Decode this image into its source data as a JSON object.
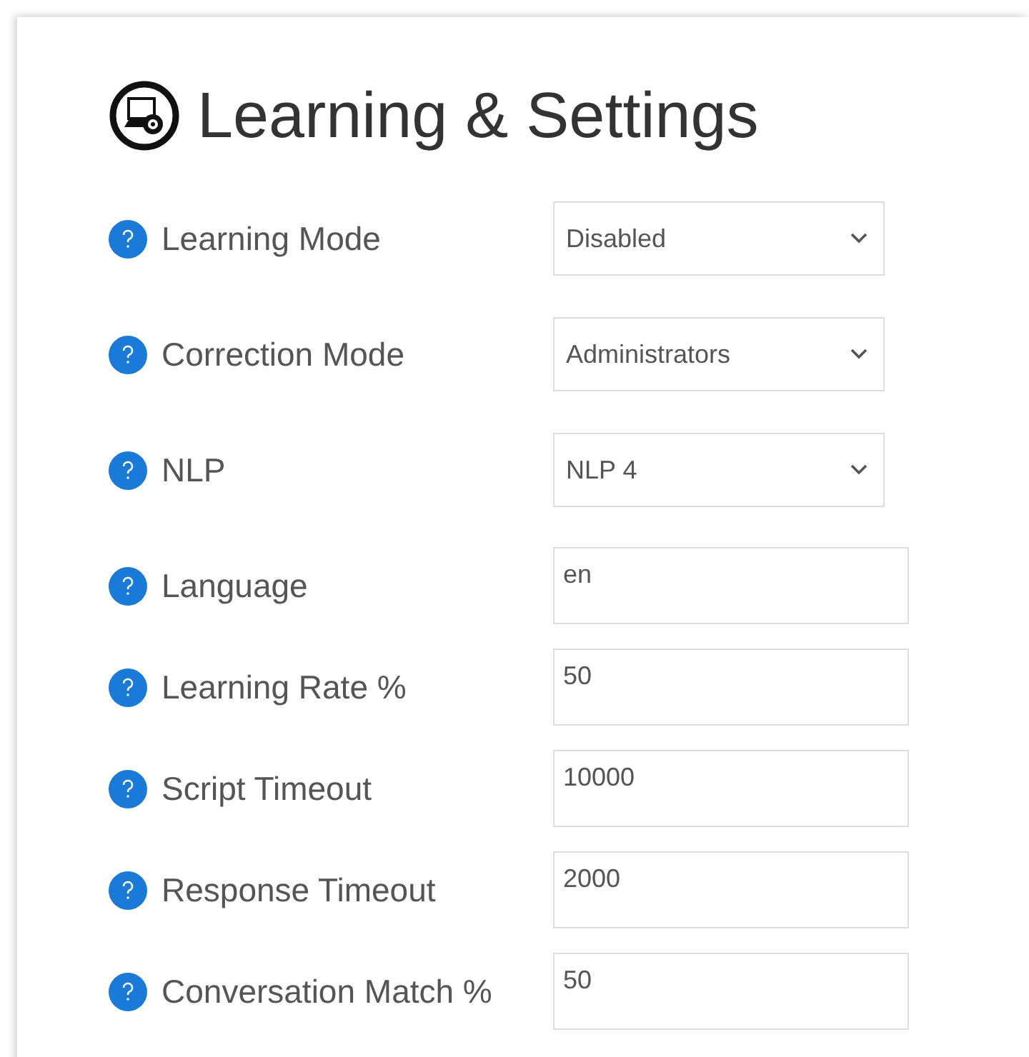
{
  "title": "Learning & Settings",
  "settings": [
    {
      "label": "Learning Mode",
      "kind": "select",
      "value": "Disabled"
    },
    {
      "label": "Correction Mode",
      "kind": "select",
      "value": "Administrators"
    },
    {
      "label": "NLP",
      "kind": "select",
      "value": "NLP 4"
    },
    {
      "label": "Language",
      "kind": "text",
      "value": "en"
    },
    {
      "label": "Learning Rate %",
      "kind": "text",
      "value": "50"
    },
    {
      "label": "Script Timeout",
      "kind": "text",
      "value": "10000"
    },
    {
      "label": "Response Timeout",
      "kind": "text",
      "value": "2000"
    },
    {
      "label": "Conversation Match %",
      "kind": "text",
      "value": "50"
    }
  ]
}
